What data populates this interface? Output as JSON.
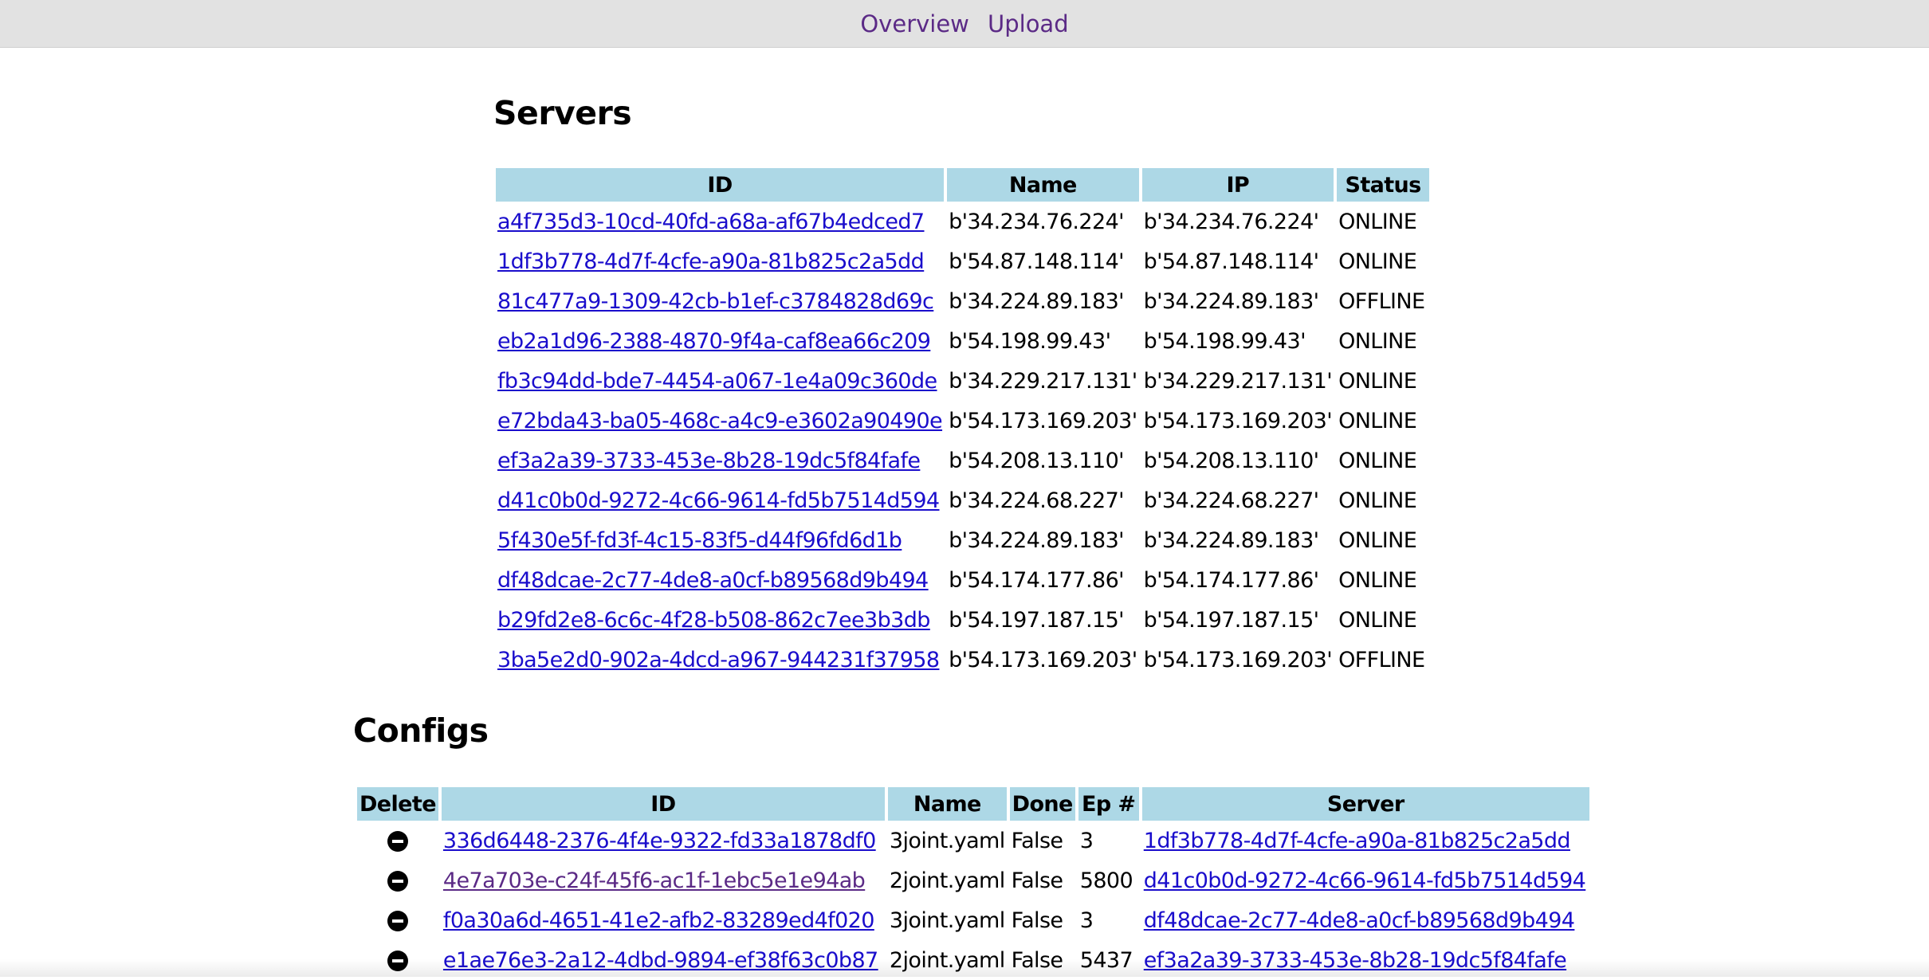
{
  "nav": {
    "overview": "Overview",
    "upload": "Upload"
  },
  "servers": {
    "heading": "Servers",
    "columns": [
      "ID",
      "Name",
      "IP",
      "Status"
    ],
    "rows": [
      {
        "id": "a4f735d3-10cd-40fd-a68a-af67b4edced7",
        "name": "b'34.234.76.224'",
        "ip": "b'34.234.76.224'",
        "status": "ONLINE"
      },
      {
        "id": "1df3b778-4d7f-4cfe-a90a-81b825c2a5dd",
        "name": "b'54.87.148.114'",
        "ip": "b'54.87.148.114'",
        "status": "ONLINE"
      },
      {
        "id": "81c477a9-1309-42cb-b1ef-c3784828d69c",
        "name": "b'34.224.89.183'",
        "ip": "b'34.224.89.183'",
        "status": "OFFLINE"
      },
      {
        "id": "eb2a1d96-2388-4870-9f4a-caf8ea66c209",
        "name": "b'54.198.99.43'",
        "ip": "b'54.198.99.43'",
        "status": "ONLINE"
      },
      {
        "id": "fb3c94dd-bde7-4454-a067-1e4a09c360de",
        "name": "b'34.229.217.131'",
        "ip": "b'34.229.217.131'",
        "status": "ONLINE"
      },
      {
        "id": "e72bda43-ba05-468c-a4c9-e3602a90490e",
        "name": "b'54.173.169.203'",
        "ip": "b'54.173.169.203'",
        "status": "ONLINE"
      },
      {
        "id": "ef3a2a39-3733-453e-8b28-19dc5f84fafe",
        "name": "b'54.208.13.110'",
        "ip": "b'54.208.13.110'",
        "status": "ONLINE"
      },
      {
        "id": "d41c0b0d-9272-4c66-9614-fd5b7514d594",
        "name": "b'34.224.68.227'",
        "ip": "b'34.224.68.227'",
        "status": "ONLINE"
      },
      {
        "id": "5f430e5f-fd3f-4c15-83f5-d44f96fd6d1b",
        "name": "b'34.224.89.183'",
        "ip": "b'34.224.89.183'",
        "status": "ONLINE"
      },
      {
        "id": "df48dcae-2c77-4de8-a0cf-b89568d9b494",
        "name": "b'54.174.177.86'",
        "ip": "b'54.174.177.86'",
        "status": "ONLINE"
      },
      {
        "id": "b29fd2e8-6c6c-4f28-b508-862c7ee3b3db",
        "name": "b'54.197.187.15'",
        "ip": "b'54.197.187.15'",
        "status": "ONLINE"
      },
      {
        "id": "3ba5e2d0-902a-4dcd-a967-944231f37958",
        "name": "b'54.173.169.203'",
        "ip": "b'54.173.169.203'",
        "status": "OFFLINE"
      }
    ]
  },
  "configs": {
    "heading": "Configs",
    "columns": [
      "Delete",
      "ID",
      "Name",
      "Done",
      "Ep #",
      "Server"
    ],
    "rows": [
      {
        "id": "336d6448-2376-4f4e-9322-fd33a1878df0",
        "name": "3joint.yaml",
        "done": "False",
        "ep": "3",
        "server": "1df3b778-4d7f-4cfe-a90a-81b825c2a5dd"
      },
      {
        "id": "4e7a703e-c24f-45f6-ac1f-1ebc5e1e94ab",
        "name": "2joint.yaml",
        "done": "False",
        "ep": "5800",
        "server": "d41c0b0d-9272-4c66-9614-fd5b7514d594"
      },
      {
        "id": "f0a30a6d-4651-41e2-afb2-83289ed4f020",
        "name": "3joint.yaml",
        "done": "False",
        "ep": "3",
        "server": "df48dcae-2c77-4de8-a0cf-b89568d9b494"
      },
      {
        "id": "e1ae76e3-2a12-4dbd-9894-ef38f63c0b87",
        "name": "2joint.yaml",
        "done": "False",
        "ep": "5437",
        "server": "ef3a2a39-3733-453e-8b28-19dc5f84fafe"
      }
    ]
  }
}
